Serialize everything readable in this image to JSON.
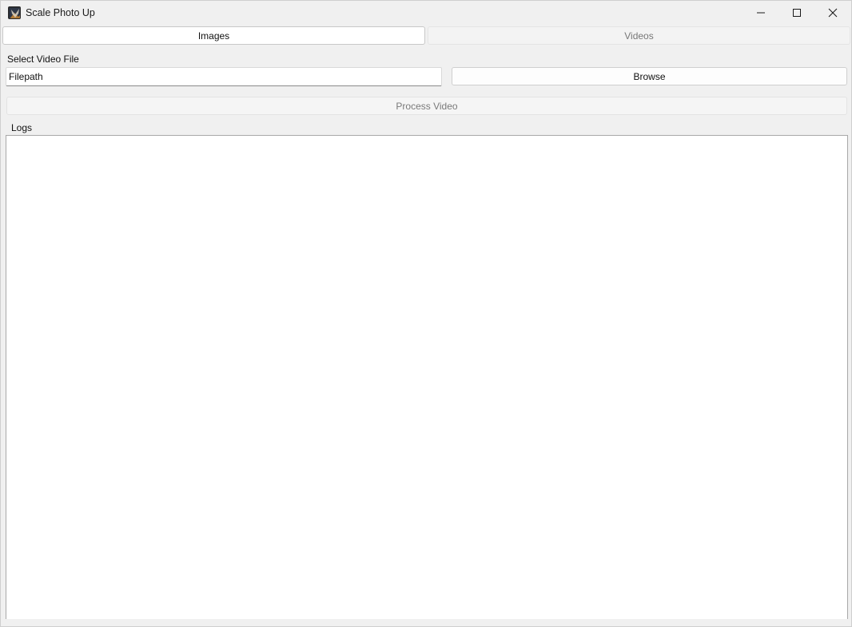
{
  "window": {
    "title": "Scale Photo Up",
    "app_icon": "app-photo-icon",
    "controls": {
      "minimize_icon": "minimize-icon",
      "maximize_icon": "maximize-icon",
      "close_icon": "close-icon"
    }
  },
  "tabs": [
    {
      "label": "Images",
      "state": "active"
    },
    {
      "label": "Videos",
      "state": "inactive"
    }
  ],
  "form": {
    "file_label": "Select Video File",
    "filepath_value": "",
    "filepath_placeholder": "Filepath",
    "browse_label": "Browse",
    "process_label": "Process Video",
    "process_enabled": false
  },
  "logs": {
    "label": "Logs",
    "content": ""
  },
  "colors": {
    "window_bg": "#f0f0f0",
    "input_bg": "#ffffff",
    "disabled_text": "#7a7a7a"
  }
}
